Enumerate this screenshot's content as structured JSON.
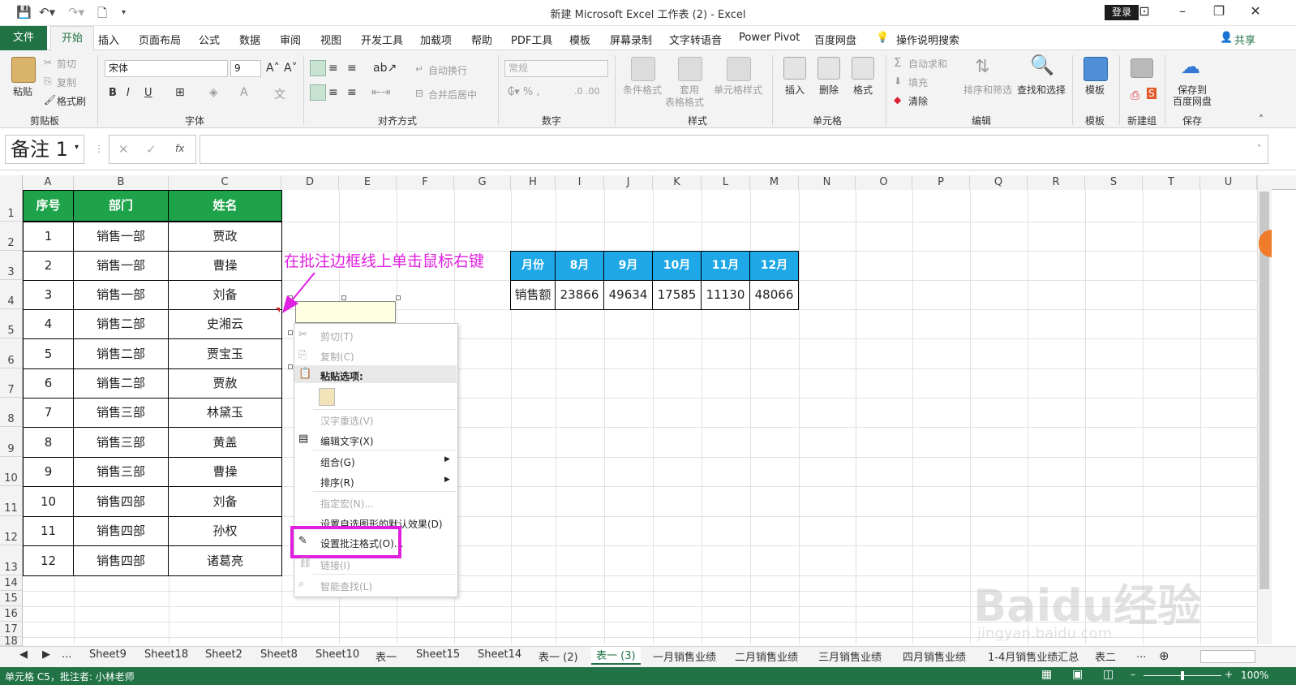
{
  "window": {
    "title": "新建 Microsoft Excel 工作表 (2)  -  Excel",
    "login": "登录"
  },
  "menu": {
    "file": "文件",
    "tabs": [
      "开始",
      "插入",
      "页面布局",
      "公式",
      "数据",
      "审阅",
      "视图",
      "开发工具",
      "加载项",
      "帮助",
      "PDF工具",
      "模板",
      "屏幕录制",
      "文字转语音",
      "Power Pivot",
      "百度网盘"
    ],
    "search": "操作说明搜索",
    "share": "共享"
  },
  "ribbon": {
    "clipboard": {
      "paste": "粘贴",
      "cut": "剪切",
      "copy": "复制",
      "format_painter": "格式刷",
      "label": "剪贴板"
    },
    "font": {
      "name": "宋体",
      "size": "9",
      "bold": "B",
      "italic": "I",
      "underline": "U",
      "label": "字体"
    },
    "alignment": {
      "wrap": "自动换行",
      "merge": "合并后居中",
      "label": "对齐方式"
    },
    "number": {
      "format": "常规",
      "label": "数字"
    },
    "styles": {
      "conditional": "条件格式",
      "table1": "套用",
      "table2": "表格格式",
      "cell_styles": "单元格样式",
      "label": "样式"
    },
    "cells": {
      "insert": "插入",
      "delete": "删除",
      "format": "格式",
      "label": "单元格"
    },
    "editing": {
      "autosum": "自动求和",
      "fill": "填充",
      "clear": "清除",
      "sort": "排序和筛选",
      "find": "查找和选择",
      "label": "编辑"
    },
    "template": {
      "btn": "模板",
      "label": "模板"
    },
    "newgroup": {
      "label": "新建组"
    },
    "save": {
      "btn1": "保存到",
      "btn2": "百度网盘",
      "label": "保存"
    }
  },
  "formula": {
    "name_box": "备注 1",
    "fx": "fx"
  },
  "columns": [
    "A",
    "B",
    "C",
    "D",
    "E",
    "F",
    "G",
    "H",
    "I",
    "J",
    "K",
    "L",
    "M",
    "N",
    "O",
    "P",
    "Q",
    "R",
    "S",
    "T",
    "U"
  ],
  "rows": [
    "1",
    "2",
    "3",
    "4",
    "5",
    "6",
    "7",
    "8",
    "9",
    "10",
    "11",
    "12",
    "13",
    "14",
    "15",
    "16",
    "17",
    "18"
  ],
  "table1": {
    "headers": [
      "序号",
      "部门",
      "姓名"
    ],
    "rows": [
      [
        "1",
        "销售一部",
        "贾政"
      ],
      [
        "2",
        "销售一部",
        "曹操"
      ],
      [
        "3",
        "销售一部",
        "刘备"
      ],
      [
        "4",
        "销售二部",
        "史湘云"
      ],
      [
        "5",
        "销售二部",
        "贾宝玉"
      ],
      [
        "6",
        "销售二部",
        "贾赦"
      ],
      [
        "7",
        "销售三部",
        "林黛玉"
      ],
      [
        "8",
        "销售三部",
        "黄盖"
      ],
      [
        "9",
        "销售三部",
        "曹操"
      ],
      [
        "10",
        "销售四部",
        "刘备"
      ],
      [
        "11",
        "销售四部",
        "孙权"
      ],
      [
        "12",
        "销售四部",
        "诸葛亮"
      ]
    ]
  },
  "table2": {
    "headers": [
      "月份",
      "8月",
      "9月",
      "10月",
      "11月",
      "12月"
    ],
    "row": [
      "销售额",
      "23866",
      "49634",
      "17585",
      "11130",
      "48066"
    ]
  },
  "annotation": "在批注边框线上单击鼠标右键",
  "context_menu": {
    "cut": "剪切(T)",
    "copy": "复制(C)",
    "paste_options": "粘贴选项:",
    "reconvert": "汉字重选(V)",
    "edit_text": "编辑文字(X)",
    "group": "组合(G)",
    "order": "排序(R)",
    "macro": "指定宏(N)...",
    "default_shape": "设置自选图形的默认效果(D)",
    "format_comment": "设置批注格式(O)...",
    "link": "链接(I)",
    "smart_lookup": "智能查找(L)"
  },
  "sheets": [
    "...",
    "Sheet9",
    "Sheet18",
    "Sheet2",
    "Sheet8",
    "Sheet10",
    "表一",
    "Sheet15",
    "Sheet14",
    "表一 (2)",
    "表一 (3)",
    "一月销售业绩",
    "二月销售业绩",
    "三月销售业绩",
    "四月销售业绩",
    "1-4月销售业绩汇总",
    "表二",
    "..."
  ],
  "status": {
    "left": "单元格 C5，批注者: 小林老师",
    "zoom": "100%"
  },
  "watermark": "Baidu经验",
  "watermark_url": "jingyan.baidu.com",
  "colors": {
    "excel_green": "#217346",
    "header_green": "#1fa34a",
    "header_blue": "#1ea8e8",
    "annotation": "#e020e0"
  }
}
